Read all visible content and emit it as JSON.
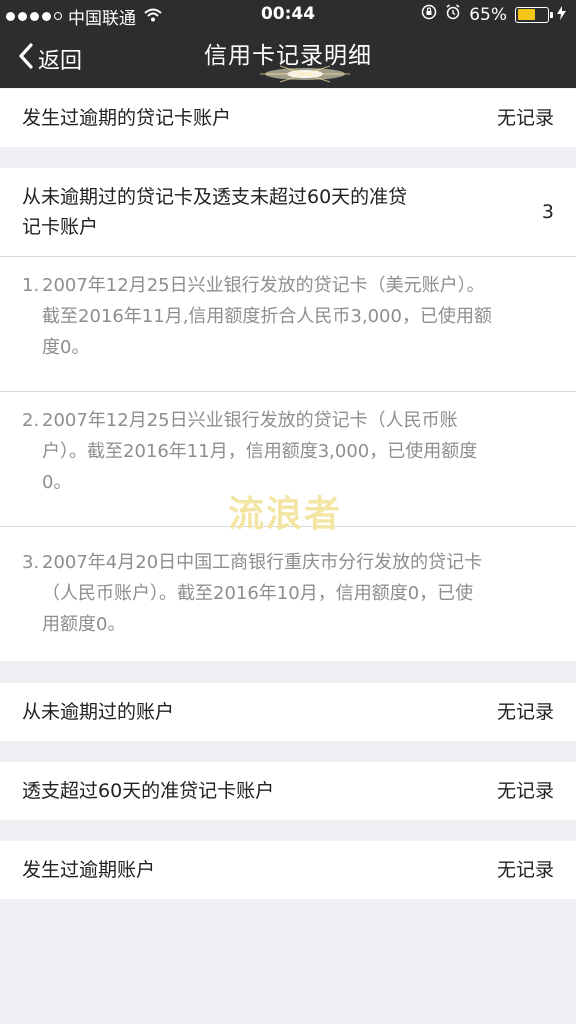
{
  "status_bar": {
    "carrier": "中国联通",
    "time": "00:44",
    "battery": "65%",
    "battery_level": 0.65,
    "icons": [
      "wifi-icon",
      "rotation-lock-icon",
      "alarm-icon",
      "battery-icon",
      "charging-icon"
    ]
  },
  "nav": {
    "back_label": "返回",
    "title": "信用卡记录明细"
  },
  "sections": {
    "overdue_debit": {
      "label": "发生过逾期的贷记卡账户",
      "value": "无记录"
    },
    "never_overdue": {
      "label_line1": "从未逾期过的贷记卡及透支未超过60天的准贷",
      "label_line2": "记卡账户",
      "value": "3",
      "items": [
        {
          "num": "1.",
          "lines": [
            "2007年12月25日兴业银行发放的贷记卡（美元账户）。",
            "截至2016年11月,信用额度折合人民币3,000，已使用额",
            "度0。"
          ]
        },
        {
          "num": "2.",
          "lines": [
            "2007年12月25日兴业银行发放的贷记卡（人民币账",
            "户）。截至2016年11月，信用额度3,000，已使用额度",
            "0。"
          ]
        },
        {
          "num": "3.",
          "lines": [
            "2007年4月20日中国工商银行重庆市分行发放的贷记卡",
            "（人民币账户）。截至2016年10月，信用额度0，已使",
            "用额度0。"
          ]
        }
      ]
    },
    "never_overdue_accounts": {
      "label": "从未逾期过的账户",
      "value": "无记录"
    },
    "overdraft_60": {
      "label": "透支超过60天的准贷记卡账户",
      "value": "无记录"
    },
    "overdue_accounts": {
      "label": "发生过逾期账户",
      "value": "无记录"
    }
  },
  "watermark": "流浪者",
  "colors": {
    "bar_bg": "#2b2d2f",
    "page_bg": "#efeff4",
    "detail_text": "#8e8e8e",
    "battery": "#f5c518"
  }
}
